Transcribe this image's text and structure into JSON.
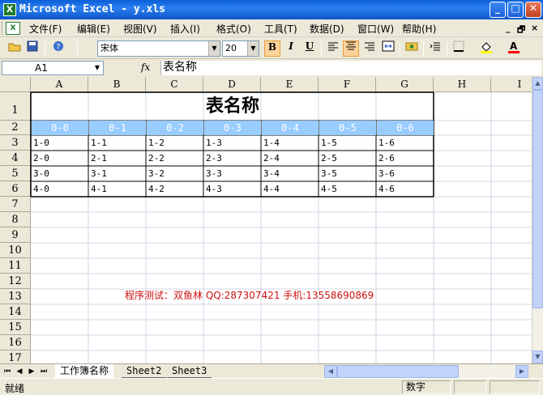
{
  "window": {
    "title": "Microsoft Excel - y.xls",
    "app_icon": "excel-icon",
    "buttons": [
      "minimize",
      "maximize",
      "close"
    ]
  },
  "menu": {
    "items": [
      "文件(F)",
      "编辑(E)",
      "视图(V)",
      "插入(I)",
      "格式(O)",
      "工具(T)",
      "数据(D)",
      "窗口(W)",
      "帮助(H)"
    ],
    "mdi_minimize": "_",
    "mdi_restore": "🗗",
    "mdi_close": "×"
  },
  "toolbar": {
    "font_name": "宋体",
    "font_size": "20",
    "bold": "B",
    "italic": "I",
    "underline": "U",
    "active_alignment": "center"
  },
  "formula_bar": {
    "name_box": "A1",
    "fx": "fx",
    "value": "表名称"
  },
  "columns": [
    "A",
    "B",
    "C",
    "D",
    "E",
    "F",
    "G",
    "H",
    "I"
  ],
  "rows": [
    "1",
    "2",
    "3",
    "4",
    "5",
    "6",
    "7",
    "8",
    "9",
    "10",
    "11",
    "12",
    "13",
    "14",
    "15",
    "16",
    "17"
  ],
  "sheet": {
    "title": "表名称",
    "headers": [
      "0-0",
      "0-1",
      "0-2",
      "0-3",
      "0-4",
      "0-5",
      "0-6"
    ],
    "data": [
      [
        "1-0",
        "1-1",
        "1-2",
        "1-3",
        "1-4",
        "1-5",
        "1-6"
      ],
      [
        "2-0",
        "2-1",
        "2-2",
        "2-3",
        "2-4",
        "2-5",
        "2-6"
      ],
      [
        "3-0",
        "3-1",
        "3-2",
        "3-3",
        "3-4",
        "3-5",
        "3-6"
      ],
      [
        "4-0",
        "4-1",
        "4-2",
        "4-3",
        "4-4",
        "4-5",
        "4-6"
      ]
    ],
    "note": "程序测试：双鱼林 QQ:287307421 手机:13558690869",
    "header_fill": "#99ccff",
    "note_color": "#cc1111"
  },
  "tabs": {
    "nav": [
      "⏮",
      "◀",
      "▶",
      "⏭"
    ],
    "sheets": [
      "工作簿名称",
      "Sheet2",
      "Sheet3"
    ],
    "active": "工作簿名称"
  },
  "status": {
    "ready": "就绪",
    "numlock": "数字"
  }
}
